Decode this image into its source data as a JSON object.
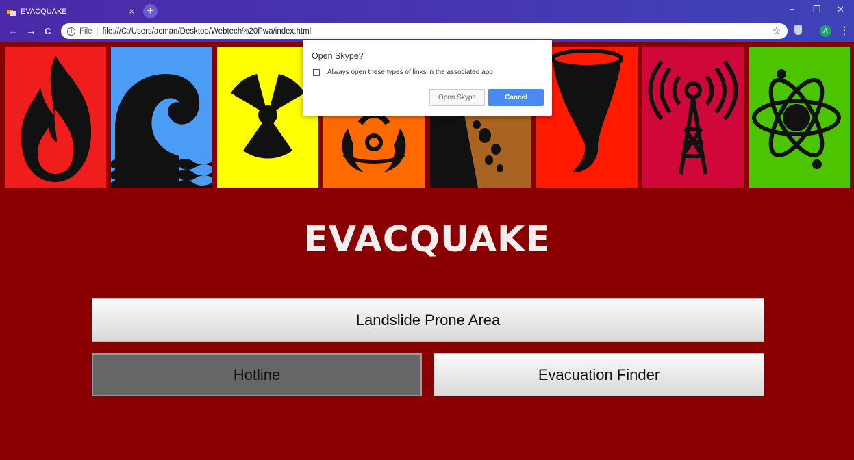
{
  "browser": {
    "tab_title": "EVACQUAKE",
    "tab_close": "×",
    "new_tab": "+",
    "address_scheme": "File",
    "address_separator": "|",
    "address_url": "file:///C:/Users/acman/Desktop/Webtech%20Pwa/index.html",
    "avatar_letter": "A",
    "window_controls": {
      "minimize": "−",
      "restore": "❐",
      "close": "✕"
    },
    "nav": {
      "back": "←",
      "forward": "→",
      "reload": "C"
    }
  },
  "banner": {
    "tiles": [
      {
        "icon": "fire-icon",
        "bg": "#f01d1d"
      },
      {
        "icon": "tsunami-icon",
        "bg": "#4a9cf5"
      },
      {
        "icon": "radiation-icon",
        "bg": "#ffff00"
      },
      {
        "icon": "biohazard-icon",
        "bg": "#ff6a00"
      },
      {
        "icon": "landslide-icon",
        "bg": "#a86420"
      },
      {
        "icon": "tornado-icon",
        "bg": "#ff1a00"
      },
      {
        "icon": "signal-tower-icon",
        "bg": "#d0083a"
      },
      {
        "icon": "atom-icon",
        "bg": "#4cc400"
      }
    ]
  },
  "main": {
    "title": "EVACQUAKE",
    "landslide_label": "Landslide Prone Area",
    "hotline_label": "Hotline",
    "evac_label": "Evacuation Finder"
  },
  "dialog": {
    "title": "Open Skype?",
    "checkbox_label": "Always open these types of links in the associated app",
    "open_label": "Open Skype",
    "cancel_label": "Cancel"
  },
  "colors": {
    "page_bg": "#8a0000",
    "accent": "#4a8af4"
  }
}
